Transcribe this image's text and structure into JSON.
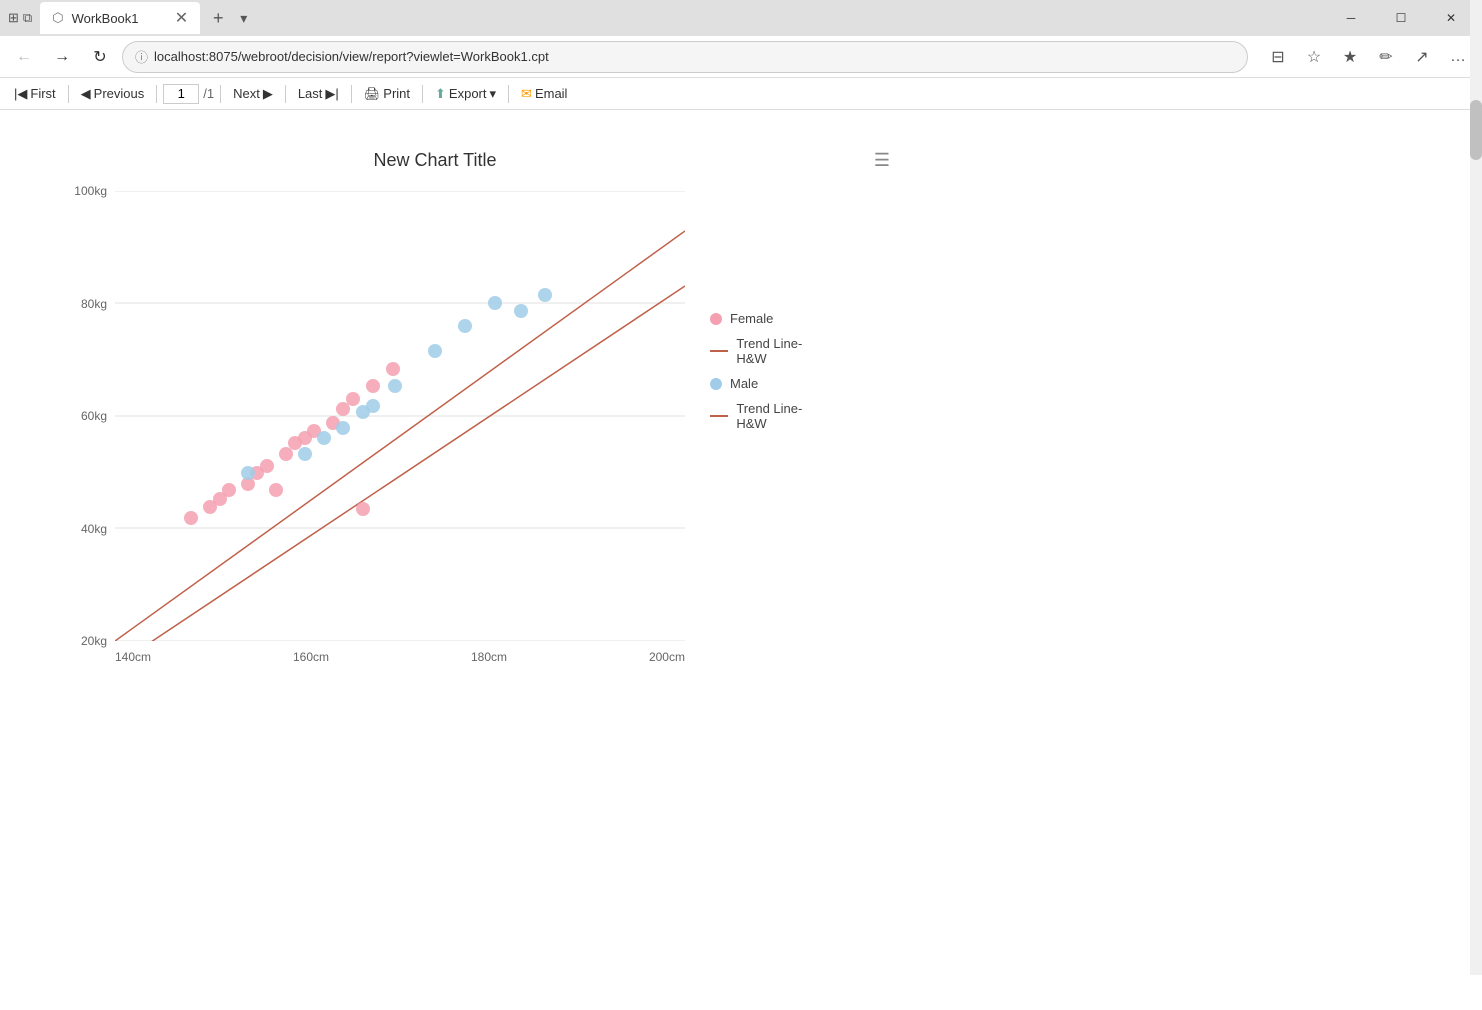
{
  "browser": {
    "tab_title": "WorkBook1",
    "url": "localhost:8075/webroot/decision/view/report?viewlet=WorkBook1.cpt",
    "new_tab_label": "+",
    "window_controls": {
      "minimize": "─",
      "maximize": "☐",
      "close": "✕"
    }
  },
  "toolbar": {
    "first_label": "First",
    "previous_label": "Previous",
    "next_label": "Next",
    "last_label": "Last",
    "page_current": "1",
    "page_total": "/1",
    "print_label": "Print",
    "export_label": "Export",
    "email_label": "Email"
  },
  "chart": {
    "title": "New Chart Title",
    "x_axis": {
      "labels": [
        "140cm",
        "160cm",
        "180cm",
        "200cm"
      ]
    },
    "y_axis": {
      "labels": [
        "100kg",
        "80kg",
        "60kg",
        "40kg",
        "20kg"
      ]
    },
    "legend": {
      "items": [
        {
          "type": "dot",
          "color": "#f4a0b0",
          "label": "Female"
        },
        {
          "type": "line",
          "color": "#c0614a",
          "label": "Trend Line-H&W"
        },
        {
          "type": "dot",
          "color": "#a0cce8",
          "label": "Male"
        },
        {
          "type": "line",
          "color": "#c0614a",
          "label": "Trend Line-H&W"
        }
      ]
    }
  }
}
